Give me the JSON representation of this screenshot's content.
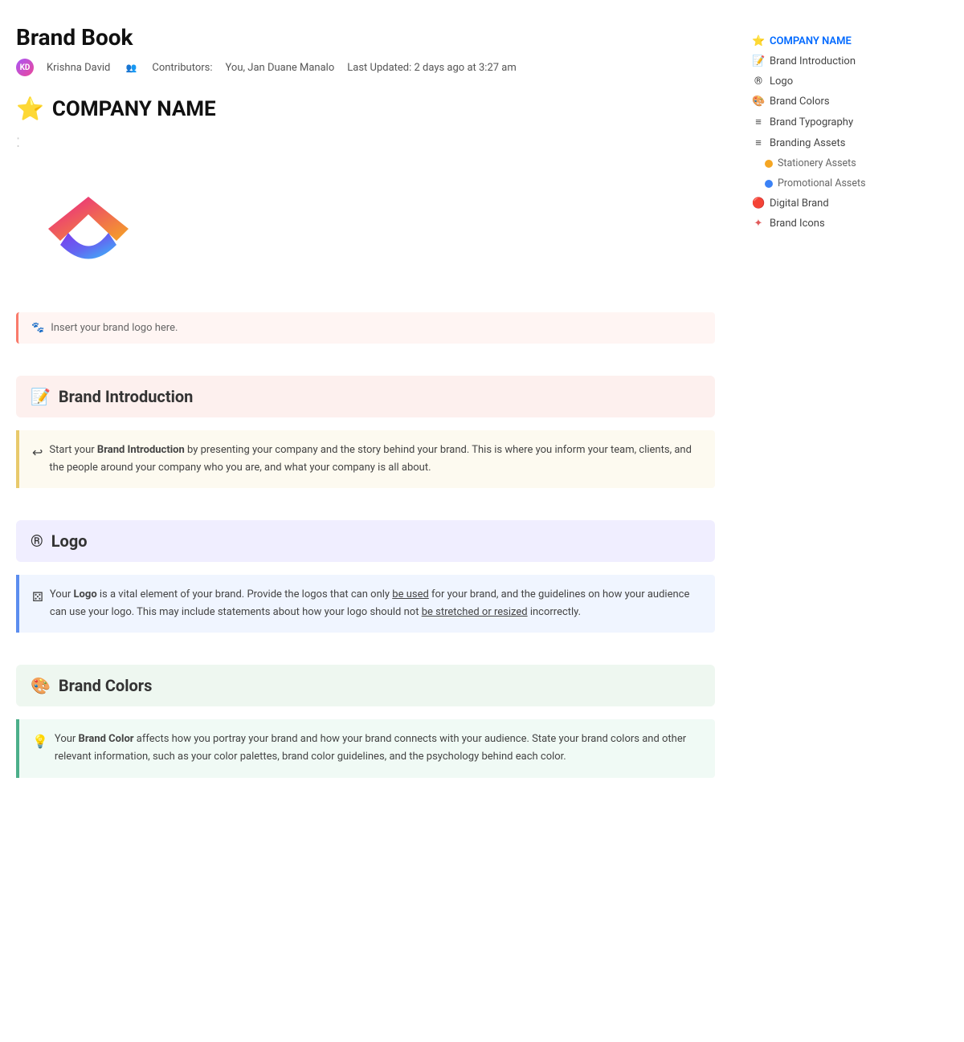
{
  "page": {
    "title": "Brand Book",
    "author": "Krishna David",
    "contributors_label": "Contributors:",
    "contributors": "You, Jan Duane Manalo",
    "last_updated": "Last Updated: 2 days ago at 3:27 am"
  },
  "company": {
    "name": "COMPANY NAME"
  },
  "callouts": {
    "insert_logo": "Insert your brand logo here."
  },
  "sections": [
    {
      "id": "brand-introduction",
      "icon": "📝",
      "title": "Brand Introduction",
      "bg": "pink-bg",
      "callout_icon": "↩",
      "callout_border": "",
      "callout_text_pre": "Start your ",
      "callout_bold": "Brand Introduction",
      "callout_text_post": " by presenting your company and the story behind your brand. This is where you inform your team, clients, and the people around your company who you are, and what your company is all about."
    },
    {
      "id": "logo",
      "icon": "®",
      "title": "Logo",
      "bg": "purple-bg",
      "callout_icon": "⚄",
      "callout_border": "blue-border",
      "callout_text_pre": "Your ",
      "callout_bold": "Logo",
      "callout_text_mid": " is a vital element of your brand. Provide the logos that can only ",
      "callout_underline1": "be used",
      "callout_text_mid2": " for your brand, and the guidelines on how your audience can use your logo. This may include statements about how your logo should not ",
      "callout_underline2": "be stretched or resized",
      "callout_text_post": " incorrectly."
    },
    {
      "id": "brand-colors",
      "icon": "🎨",
      "title": "Brand Colors",
      "bg": "green-bg",
      "callout_icon": "💡",
      "callout_border": "green-border",
      "callout_text_pre": "Your ",
      "callout_bold": "Brand Color",
      "callout_text_post": " affects how you portray your brand and how your brand connects with your audience. State your brand colors and other relevant information, such as your color palettes, brand color guidelines, and the psychology behind each color."
    }
  ],
  "sidebar": {
    "items": [
      {
        "id": "company-name",
        "label": "COMPANY NAME",
        "type": "active",
        "icon": "⭐",
        "color": "#f5a623"
      },
      {
        "id": "brand-introduction",
        "label": "Brand Introduction",
        "type": "normal",
        "icon": "📝",
        "color": "#e8845a"
      },
      {
        "id": "logo",
        "label": "Logo",
        "type": "normal",
        "icon": "®",
        "color": "#888"
      },
      {
        "id": "brand-colors",
        "label": "Brand Colors",
        "type": "normal",
        "icon": "🎨",
        "color": "#e05a5a"
      },
      {
        "id": "brand-typography",
        "label": "Brand Typography",
        "type": "normal",
        "icon": "≡",
        "color": "#888"
      },
      {
        "id": "branding-assets",
        "label": "Branding Assets",
        "type": "normal",
        "icon": "≡",
        "color": "#888"
      },
      {
        "id": "stationery-assets",
        "label": "Stationery Assets",
        "type": "sub",
        "dot_color": "#f5a623"
      },
      {
        "id": "promotional-assets",
        "label": "Promotional Assets",
        "type": "sub",
        "dot_color": "#3b82f6"
      },
      {
        "id": "digital-brand",
        "label": "Digital Brand",
        "type": "normal",
        "icon": "🔴",
        "color": "#e05a5a"
      },
      {
        "id": "brand-icons",
        "label": "Brand Icons",
        "type": "normal",
        "icon": "✦",
        "color": "#e05a5a"
      }
    ]
  }
}
